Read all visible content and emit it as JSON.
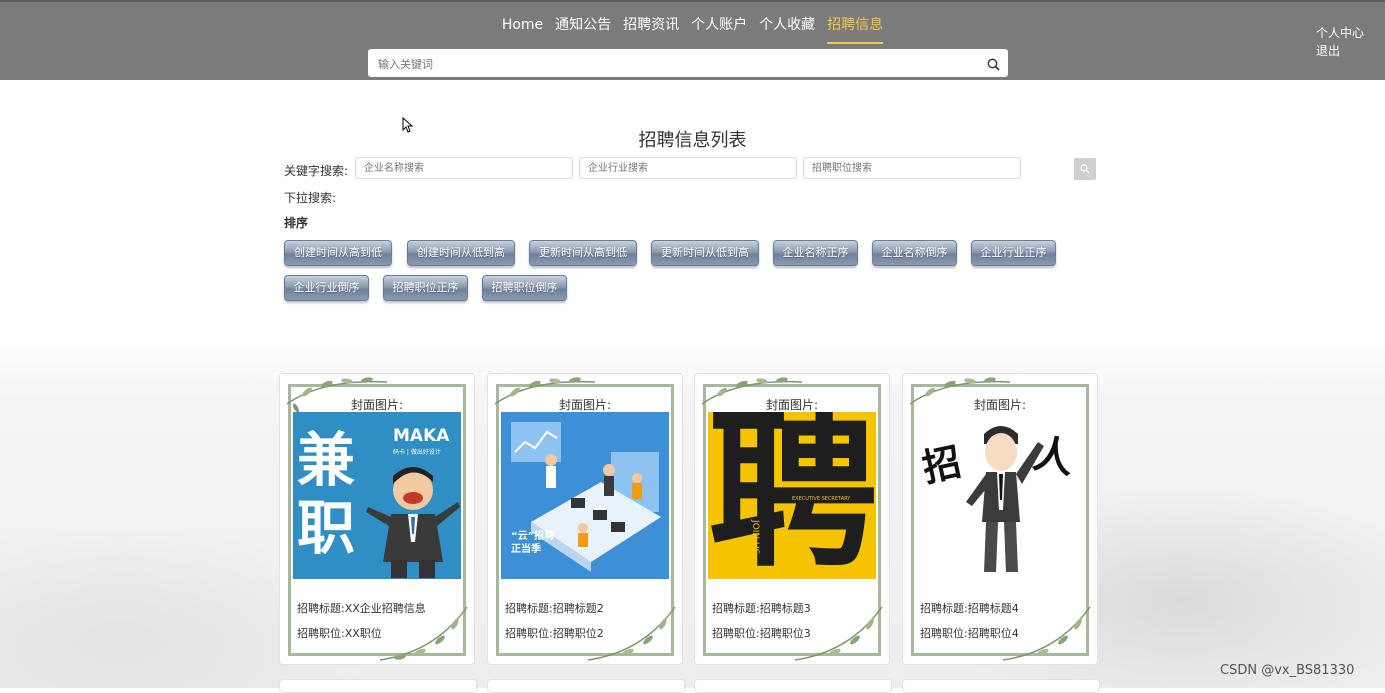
{
  "nav": {
    "items": [
      "Home",
      "通知公告",
      "招聘资讯",
      "个人账户",
      "个人收藏",
      "招聘信息"
    ],
    "active_index": 5,
    "active_color": "#f2c94c"
  },
  "search": {
    "placeholder": "输入关键词"
  },
  "user_menu": {
    "center": "个人中心",
    "logout": "退出"
  },
  "page": {
    "title": "招聘信息列表"
  },
  "filters": {
    "keyword_label": "关键字搜索:",
    "company_placeholder": "企业名称搜索",
    "industry_placeholder": "企业行业搜索",
    "position_placeholder": "招聘职位搜索",
    "dropdown_label": "下拉搜索:",
    "sort_label": "排序"
  },
  "sort_buttons": [
    "创建时间从高到低",
    "创建时间从低到高",
    "更新时间从高到低",
    "更新时间从低到高",
    "企业名称正序",
    "企业名称倒序",
    "企业行业正序",
    "企业行业倒序",
    "招聘职位正序",
    "招聘职位倒序"
  ],
  "cards": [
    {
      "cover_label": "封面图片:",
      "title": "招聘标题:XX企业招聘信息",
      "position": "招聘职位:XX职位",
      "cover": {
        "big_text": "兼职",
        "brand": "MAKA",
        "sub": "码卡 | 做出好设计"
      }
    },
    {
      "cover_label": "封面图片:",
      "title": "招聘标题:招聘标题2",
      "position": "招聘职位:招聘职位2",
      "cover": {
        "big_text": "“云”招聘 正当季"
      }
    },
    {
      "cover_label": "封面图片:",
      "title": "招聘标题:招聘标题3",
      "position": "招聘职位:招聘职位3",
      "cover": {
        "big_text": "聘",
        "sub": "JOIN US",
        "sub2": "EXECUTIVE SECRETARY"
      }
    },
    {
      "cover_label": "封面图片:",
      "title": "招聘标题:招聘标题4",
      "position": "招聘职位:招聘职位4",
      "cover": {
        "left_text": "招",
        "right_text": "人"
      }
    }
  ],
  "watermark": "CSDN @vx_BS81330",
  "colors": {
    "topbar": "#7b7b7b",
    "accent": "#f2c94c",
    "sort_button": "#8b9bb2"
  }
}
